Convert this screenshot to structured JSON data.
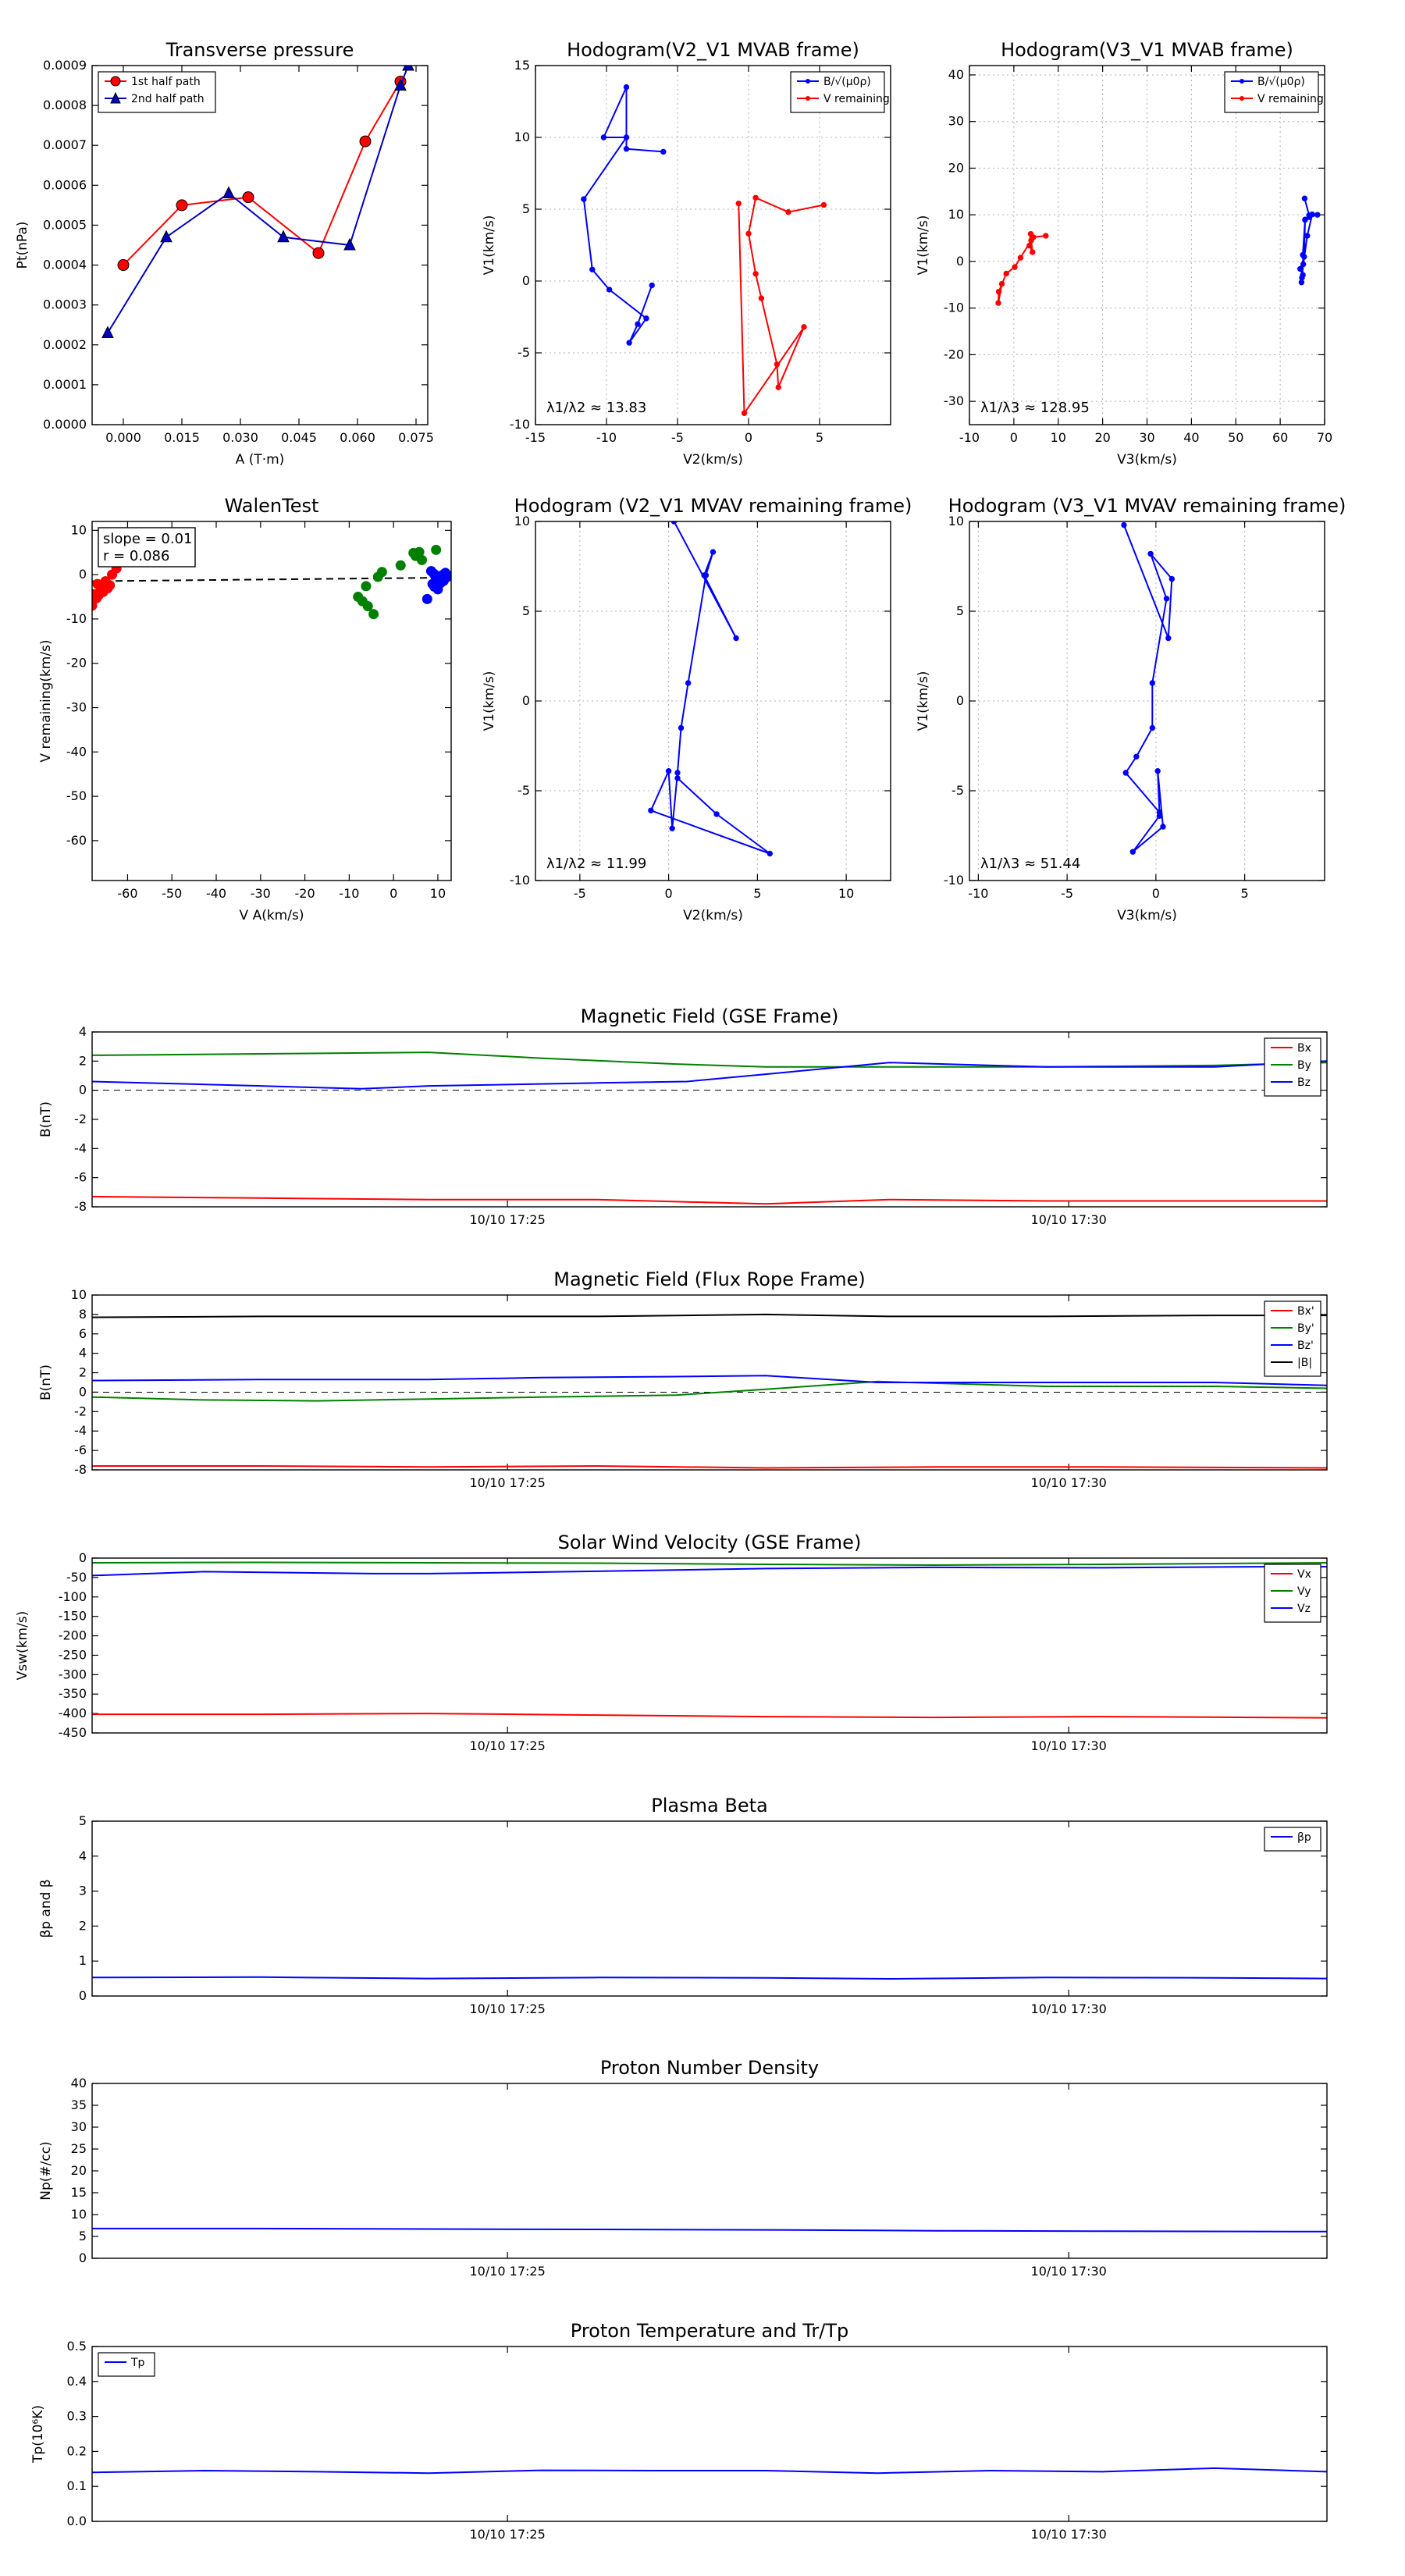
{
  "chart_data": [
    {
      "id": "tp",
      "type": "line",
      "title": "Transverse pressure",
      "xlabel": "A (T·m)",
      "ylabel": "Pt(nPa)",
      "xlim": [
        -0.008,
        0.078
      ],
      "ylim": [
        0,
        0.0009
      ],
      "xticks": [
        0,
        0.015,
        0.03,
        0.045,
        0.06,
        0.075
      ],
      "xtick_labels": [
        "0.000",
        "0.015",
        "0.030",
        "0.045",
        "0.060",
        "0.075"
      ],
      "yticks": [
        0,
        0.0001,
        0.0002,
        0.0003,
        0.0004,
        0.0005,
        0.0006,
        0.0007,
        0.0008,
        0.0009
      ],
      "ytick_labels": [
        "0.0000",
        "0.0001",
        "0.0002",
        "0.0003",
        "0.0004",
        "0.0005",
        "0.0006",
        "0.0007",
        "0.0008",
        "0.0009"
      ],
      "legend": "top-left",
      "series": [
        {
          "name": "1st half path",
          "color": "#ff0000",
          "marker": "circle",
          "x": [
            0.0,
            0.015,
            0.032,
            0.05,
            0.062,
            0.071
          ],
          "y": [
            0.0004,
            0.00055,
            0.00057,
            0.00043,
            0.00071,
            0.00086
          ]
        },
        {
          "name": "2nd half path",
          "color": "#0000bf",
          "marker": "triangle",
          "x": [
            -0.004,
            0.011,
            0.027,
            0.041,
            0.058,
            0.071,
            0.073
          ],
          "y": [
            0.00023,
            0.00047,
            0.00058,
            0.00047,
            0.00045,
            0.00085,
            0.0009
          ]
        }
      ]
    },
    {
      "id": "h1",
      "type": "line",
      "title": "Hodogram(V2_V1 MVAB frame)",
      "xlabel": "V2(km/s)",
      "ylabel": "V1(km/s)",
      "xlim": [
        -15,
        10
      ],
      "ylim": [
        -10,
        15
      ],
      "xticks": [
        -15,
        -10,
        -5,
        0,
        5
      ],
      "yticks": [
        -10,
        -5,
        0,
        5,
        10,
        15
      ],
      "annotation": "λ1/λ2 ≈ 13.83",
      "legend": "top-right",
      "series": [
        {
          "name": "B/√(μ0ρ)",
          "color": "#0000ff",
          "marker": "dot",
          "x": [
            -6,
            -8.6,
            -8.6,
            -10.2,
            -8.6,
            -11.6,
            -11,
            -9.8,
            -7.2,
            -8.4,
            -7.8,
            -6.8
          ],
          "y": [
            9,
            9.2,
            13.5,
            10,
            10,
            5.7,
            0.8,
            -0.6,
            -2.6,
            -4.3,
            -3,
            -0.3
          ]
        },
        {
          "name": "V remaining",
          "color": "#ff0000",
          "marker": "dot",
          "x": [
            5.3,
            2.8,
            0.5,
            0,
            0.5,
            0.9,
            2,
            2.1,
            3.9,
            -0.3,
            -0.7
          ],
          "y": [
            5.3,
            4.8,
            5.8,
            3.3,
            0.5,
            -1.2,
            -5.8,
            -7.4,
            -3.2,
            -9.2,
            5.4
          ]
        }
      ]
    },
    {
      "id": "h2",
      "type": "line",
      "title": "Hodogram(V3_V1 MVAB frame)",
      "xlabel": "V3(km/s)",
      "ylabel": "V1(km/s)",
      "xlim": [
        -10,
        70
      ],
      "ylim": [
        -35,
        42
      ],
      "xticks": [
        -10,
        0,
        10,
        20,
        30,
        40,
        50,
        60,
        70
      ],
      "yticks": [
        -30,
        -20,
        -10,
        0,
        10,
        20,
        30,
        40
      ],
      "annotation": "λ1/λ3 ≈ 128.95",
      "legend": "top-right",
      "series": [
        {
          "name": "B/√(μ0ρ)",
          "color": "#0000ff",
          "marker": "dot",
          "x": [
            65.5,
            66.5,
            65.6,
            65.4,
            64.5,
            65.1,
            64.8,
            64.9,
            65.2,
            66.1,
            67.2,
            68.4,
            66.6,
            65.6,
            65.1
          ],
          "y": [
            13.5,
            9.9,
            8.9,
            1,
            -1.6,
            -2.9,
            -4.5,
            -3.5,
            -0.6,
            5.5,
            10.1,
            10,
            9.5,
            9,
            1.4
          ]
        },
        {
          "name": "V remaining",
          "color": "#ff0000",
          "marker": "dot",
          "x": [
            7.2,
            4.4,
            3.8,
            3.5,
            4.2,
            3.9,
            1.5,
            0.2,
            -1.7,
            -3.4,
            -3.5,
            -2.7
          ],
          "y": [
            5.5,
            5.2,
            5.9,
            3.4,
            2,
            4.5,
            0.8,
            -1.2,
            -2.6,
            -6.5,
            -8.9,
            -4.8
          ]
        }
      ]
    },
    {
      "id": "walen",
      "type": "scatter",
      "title": "WalenTest",
      "xlabel": "V A(km/s)",
      "ylabel": "V remaining(km/s)",
      "xlim": [
        -68,
        13
      ],
      "ylim": [
        -69,
        12
      ],
      "xticks": [
        -60,
        -50,
        -40,
        -30,
        -20,
        -10,
        0,
        10
      ],
      "yticks": [
        -60,
        -50,
        -40,
        -30,
        -20,
        -10,
        0,
        10
      ],
      "annotation": [
        "slope = 0.01",
        "r = 0.086"
      ],
      "fit": {
        "slope": 0.01,
        "intercept": -0.8
      },
      "series": [
        {
          "color": "#ff0000",
          "x": [
            -68,
            -67,
            -66.5,
            -66,
            -65.5,
            -65,
            -64.5,
            -64,
            -63.5,
            -62.5,
            -67.5,
            -66.8
          ],
          "y": [
            -7,
            -5.3,
            -4.6,
            -3,
            -3.9,
            -1.5,
            -3.1,
            -2.4,
            0,
            1.4,
            -4.4,
            -2.1
          ]
        },
        {
          "color": "#008000",
          "x": [
            -8,
            -7,
            -6.2,
            -5.8,
            -4.5,
            -3.5,
            -2.6,
            1.6,
            5,
            5.8,
            6.4,
            9.6,
            4.5
          ],
          "y": [
            -5,
            -6,
            -2.6,
            -7.1,
            -8.9,
            -0.5,
            0.6,
            2.1,
            4.2,
            5.1,
            3.3,
            5.6,
            4.9
          ]
        },
        {
          "color": "#0000ff",
          "x": [
            7.6,
            8.5,
            8.8,
            9.2,
            9.5,
            10,
            10.3,
            10.6,
            11,
            11.3,
            11.7,
            12,
            12.4,
            9.1,
            10.8
          ],
          "y": [
            -5.5,
            0.8,
            -2.1,
            -2.7,
            -0.5,
            -3.3,
            -0.9,
            -1.9,
            -0.1,
            -1.4,
            0.4,
            -0.6,
            -0.3,
            0.2,
            -1.1
          ]
        }
      ]
    },
    {
      "id": "h3",
      "type": "line",
      "title": "Hodogram (V2_V1 MVAV remaining frame)",
      "xlabel": "V2(km/s)",
      "ylabel": "V1(km/s)",
      "xlim": [
        -7.5,
        12.5
      ],
      "ylim": [
        -10,
        10
      ],
      "xticks": [
        -5,
        0,
        5,
        10
      ],
      "yticks": [
        -10,
        -5,
        0,
        5,
        10
      ],
      "annotation": "λ1/λ2 ≈ 11.99",
      "series": [
        {
          "color": "#0000ff",
          "marker": "dot",
          "x": [
            0.3,
            3.8,
            2,
            2.5,
            2.1,
            1.1,
            0.7,
            0.5,
            0.2,
            0,
            -1,
            5.7,
            2.7,
            0.5
          ],
          "y": [
            10,
            3.5,
            7,
            8.3,
            7,
            1,
            -1.5,
            -4,
            -7.1,
            -3.9,
            -6.1,
            -8.5,
            -6.3,
            -4.3
          ]
        }
      ]
    },
    {
      "id": "h4",
      "type": "line",
      "title": "Hodogram (V3_V1 MVAV remaining frame)",
      "xlabel": "V3(km/s)",
      "ylabel": "V1(km/s)",
      "xlim": [
        -10.5,
        9.5
      ],
      "ylim": [
        -10,
        10
      ],
      "xticks": [
        -10,
        -5,
        0,
        5
      ],
      "yticks": [
        -10,
        -5,
        0,
        5,
        10
      ],
      "annotation": "λ1/λ3 ≈ 51.44",
      "series": [
        {
          "color": "#0000ff",
          "marker": "dot",
          "x": [
            -1.8,
            0.7,
            0.9,
            -0.3,
            0.6,
            -0.2,
            -0.2,
            -1.1,
            -1.7,
            0.2,
            0.1,
            0.4,
            -1.3,
            0.2
          ],
          "y": [
            9.8,
            3.5,
            6.8,
            8.2,
            5.7,
            1,
            -1.5,
            -3.1,
            -4,
            -6.2,
            -3.9,
            -7,
            -8.4,
            -6.4
          ]
        }
      ]
    },
    {
      "id": "bgse",
      "type": "line",
      "title": "Magnetic Field (GSE Frame)",
      "ylabel": "B(nT)",
      "xlim": [
        0,
        11
      ],
      "ylim": [
        -8,
        4
      ],
      "yticks": [
        -8,
        -6,
        -4,
        -2,
        0,
        2,
        4
      ],
      "xtick_pos": [
        3.7,
        8.7
      ],
      "xtick_labels": [
        "10/10 17:25",
        "10/10 17:30"
      ],
      "zero_line": true,
      "legend": "top-right",
      "series": [
        {
          "name": "Bx",
          "color": "#ff0000",
          "x": [
            0,
            1.5,
            3,
            4.5,
            6,
            7.1,
            8.5,
            10,
            11
          ],
          "y": [
            -7.3,
            -7.4,
            -7.5,
            -7.5,
            -7.8,
            -7.5,
            -7.6,
            -7.6,
            -7.6
          ]
        },
        {
          "name": "By",
          "color": "#008000",
          "x": [
            0,
            1.5,
            3,
            4,
            5.2,
            6,
            7.1,
            8.5,
            10,
            11
          ],
          "y": [
            2.4,
            2.5,
            2.6,
            2.2,
            1.8,
            1.6,
            1.6,
            1.6,
            1.7,
            1.9
          ]
        },
        {
          "name": "Bz",
          "color": "#0000ff",
          "x": [
            0,
            1.5,
            2.4,
            3,
            4.5,
            5.3,
            6,
            7.1,
            8.5,
            10,
            11
          ],
          "y": [
            0.6,
            0.3,
            0.1,
            0.3,
            0.5,
            0.6,
            1.1,
            1.9,
            1.6,
            1.6,
            2
          ]
        }
      ]
    },
    {
      "id": "bfr",
      "type": "line",
      "title": "Magnetic Field (Flux Rope Frame)",
      "ylabel": "B(nT)",
      "xlim": [
        0,
        11
      ],
      "ylim": [
        -8,
        10
      ],
      "yticks": [
        -8,
        -6,
        -4,
        -2,
        0,
        2,
        4,
        6,
        8,
        10
      ],
      "xtick_pos": [
        3.7,
        8.7
      ],
      "xtick_labels": [
        "10/10 17:25",
        "10/10 17:30"
      ],
      "zero_line": true,
      "legend": "top-right",
      "series": [
        {
          "name": "Bx'",
          "color": "#ff0000",
          "x": [
            0,
            1.5,
            3,
            4.5,
            6,
            7.5,
            9,
            11
          ],
          "y": [
            -7.6,
            -7.6,
            -7.7,
            -7.6,
            -7.8,
            -7.7,
            -7.7,
            -7.8
          ]
        },
        {
          "name": "By'",
          "color": "#008000",
          "x": [
            0,
            1,
            2,
            3,
            4,
            5.2,
            6,
            7,
            8.5,
            10,
            11
          ],
          "y": [
            -0.5,
            -0.8,
            -0.9,
            -0.7,
            -0.5,
            -0.3,
            0.3,
            1.1,
            0.6,
            0.6,
            0.4
          ]
        },
        {
          "name": "Bz'",
          "color": "#0000ff",
          "x": [
            0,
            1.5,
            3,
            4,
            5.2,
            6,
            7,
            8.5,
            10,
            11
          ],
          "y": [
            1.2,
            1.3,
            1.3,
            1.5,
            1.6,
            1.7,
            1,
            1,
            1,
            0.7
          ]
        },
        {
          "name": "|B|",
          "color": "#000000",
          "x": [
            0,
            1.5,
            3,
            4.5,
            6,
            7.1,
            8.5,
            10,
            11
          ],
          "y": [
            7.7,
            7.8,
            7.8,
            7.8,
            8,
            7.8,
            7.8,
            7.9,
            7.9
          ]
        }
      ]
    },
    {
      "id": "vsw",
      "type": "line",
      "title": "Solar Wind Velocity (GSE Frame)",
      "ylabel": "Vsw(km/s)",
      "xlim": [
        0,
        11
      ],
      "ylim": [
        -450,
        0
      ],
      "yticks": [
        -450,
        -400,
        -350,
        -300,
        -250,
        -200,
        -150,
        -100,
        -50,
        0
      ],
      "xtick_pos": [
        3.7,
        8.7
      ],
      "xtick_labels": [
        "10/10 17:25",
        "10/10 17:30"
      ],
      "legend": "top-right",
      "series": [
        {
          "name": "Vx",
          "color": "#ff0000",
          "x": [
            0,
            1.5,
            3,
            4.5,
            6,
            7.5,
            9,
            11
          ],
          "y": [
            -402,
            -402,
            -400,
            -404,
            -408,
            -410,
            -408,
            -411
          ]
        },
        {
          "name": "Vy",
          "color": "#008000",
          "x": [
            0,
            1.5,
            3,
            4.5,
            6,
            7.5,
            9,
            10.5,
            11
          ],
          "y": [
            -12,
            -11,
            -12,
            -13,
            -16,
            -18,
            -16,
            -13,
            -12
          ]
        },
        {
          "name": "Vz",
          "color": "#0000ff",
          "x": [
            0,
            1,
            2.5,
            3,
            4.5,
            6,
            7.5,
            9,
            10.5,
            11
          ],
          "y": [
            -45,
            -35,
            -40,
            -40,
            -34,
            -27,
            -24,
            -25,
            -22,
            -22
          ]
        }
      ]
    },
    {
      "id": "beta",
      "type": "line",
      "title": "Plasma Beta",
      "ylabel": "βp and β",
      "xlim": [
        0,
        11
      ],
      "ylim": [
        0,
        5
      ],
      "yticks": [
        0,
        1,
        2,
        3,
        4,
        5
      ],
      "xtick_pos": [
        3.7,
        8.7
      ],
      "xtick_labels": [
        "10/10 17:25",
        "10/10 17:30"
      ],
      "legend": "top-right",
      "series": [
        {
          "name": "βp",
          "color": "#0000ff",
          "x": [
            0,
            1.5,
            3,
            4.5,
            6,
            7.1,
            8.5,
            10,
            11
          ],
          "y": [
            0.53,
            0.54,
            0.5,
            0.53,
            0.52,
            0.49,
            0.53,
            0.52,
            0.5
          ]
        }
      ]
    },
    {
      "id": "np",
      "type": "line",
      "title": "Proton Number Density",
      "ylabel": "Np(#/cc)",
      "xlim": [
        0,
        11
      ],
      "ylim": [
        0,
        40
      ],
      "yticks": [
        0,
        5,
        10,
        15,
        20,
        25,
        30,
        35,
        40
      ],
      "xtick_pos": [
        3.7,
        8.7
      ],
      "xtick_labels": [
        "10/10 17:25",
        "10/10 17:30"
      ],
      "series": [
        {
          "color": "#0000ff",
          "x": [
            0,
            1.5,
            3,
            4.5,
            6,
            7.5,
            9,
            11
          ],
          "y": [
            6.8,
            6.8,
            6.7,
            6.6,
            6.5,
            6.3,
            6.2,
            6.1
          ]
        }
      ]
    },
    {
      "id": "tpp",
      "type": "line",
      "title": "Proton Temperature and Tr/Tp",
      "ylabel": "Tp(10⁶K)",
      "xlim": [
        0,
        11
      ],
      "ylim": [
        0,
        0.5
      ],
      "yticks": [
        0,
        0.1,
        0.2,
        0.3,
        0.4,
        0.5
      ],
      "ytick_labels": [
        "0.0",
        "0.1",
        "0.2",
        "0.3",
        "0.4",
        "0.5"
      ],
      "xtick_pos": [
        3.7,
        8.7
      ],
      "xtick_labels": [
        "10/10 17:25",
        "10/10 17:30"
      ],
      "legend": "top-left",
      "series": [
        {
          "name": "Tp",
          "color": "#0000ff",
          "x": [
            0,
            1,
            2,
            3,
            4,
            5,
            6,
            7,
            8,
            9,
            10,
            11
          ],
          "y": [
            0.14,
            0.145,
            0.142,
            0.138,
            0.146,
            0.145,
            0.145,
            0.138,
            0.145,
            0.142,
            0.152,
            0.142
          ]
        }
      ]
    }
  ]
}
